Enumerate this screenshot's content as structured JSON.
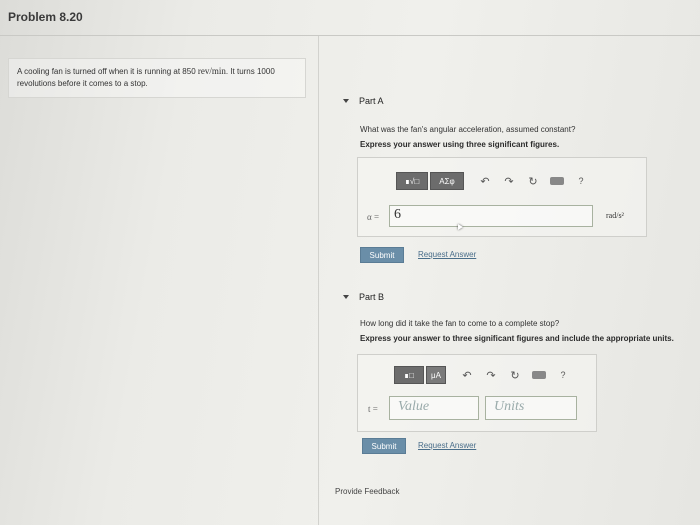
{
  "header": {
    "title": "Problem 8.20"
  },
  "problem": {
    "text_before": "A cooling fan is turned off when it is running at 850 ",
    "unit": "rev/min",
    "text_after": ". It turns 1000 revolutions before it comes to a stop."
  },
  "part_a": {
    "label": "Part A",
    "question": "What was the fan's angular acceleration, assumed constant?",
    "instructions": "Express your answer using three significant figures.",
    "toolbar": {
      "matrix_label": "∎√□",
      "greek_label": "ΑΣφ"
    },
    "variable": "α =",
    "value": "6",
    "unit_suffix": "rad/s²",
    "submit": "Submit",
    "request": "Request Answer"
  },
  "part_b": {
    "label": "Part B",
    "question": "How long did it take the fan to come to a complete stop?",
    "instructions": "Express your answer to three significant figures and include the appropriate units.",
    "toolbar": {
      "matrix_label": "∎□",
      "units_label": "μA"
    },
    "variable": "t =",
    "value_placeholder": "Value",
    "units_placeholder": "Units",
    "submit": "Submit",
    "request": "Request Answer"
  },
  "footer": {
    "feedback": "Provide Feedback"
  }
}
